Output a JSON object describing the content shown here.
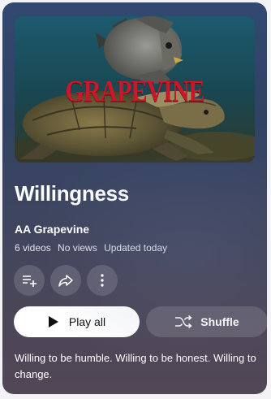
{
  "playlist": {
    "thumbnail_text": "GRAPEVINE",
    "title": "Willingness",
    "channel": "AA Grapevine",
    "video_count": "6 videos",
    "views": "No views",
    "updated": "Updated today",
    "description": "Willing to be humble. Willing to be honest. Willing to change."
  },
  "actions": {
    "add_icon": "playlist-add-icon",
    "share_icon": "share-icon",
    "more_icon": "more-vertical-icon"
  },
  "buttons": {
    "play_all": "Play all",
    "shuffle": "Shuffle"
  }
}
